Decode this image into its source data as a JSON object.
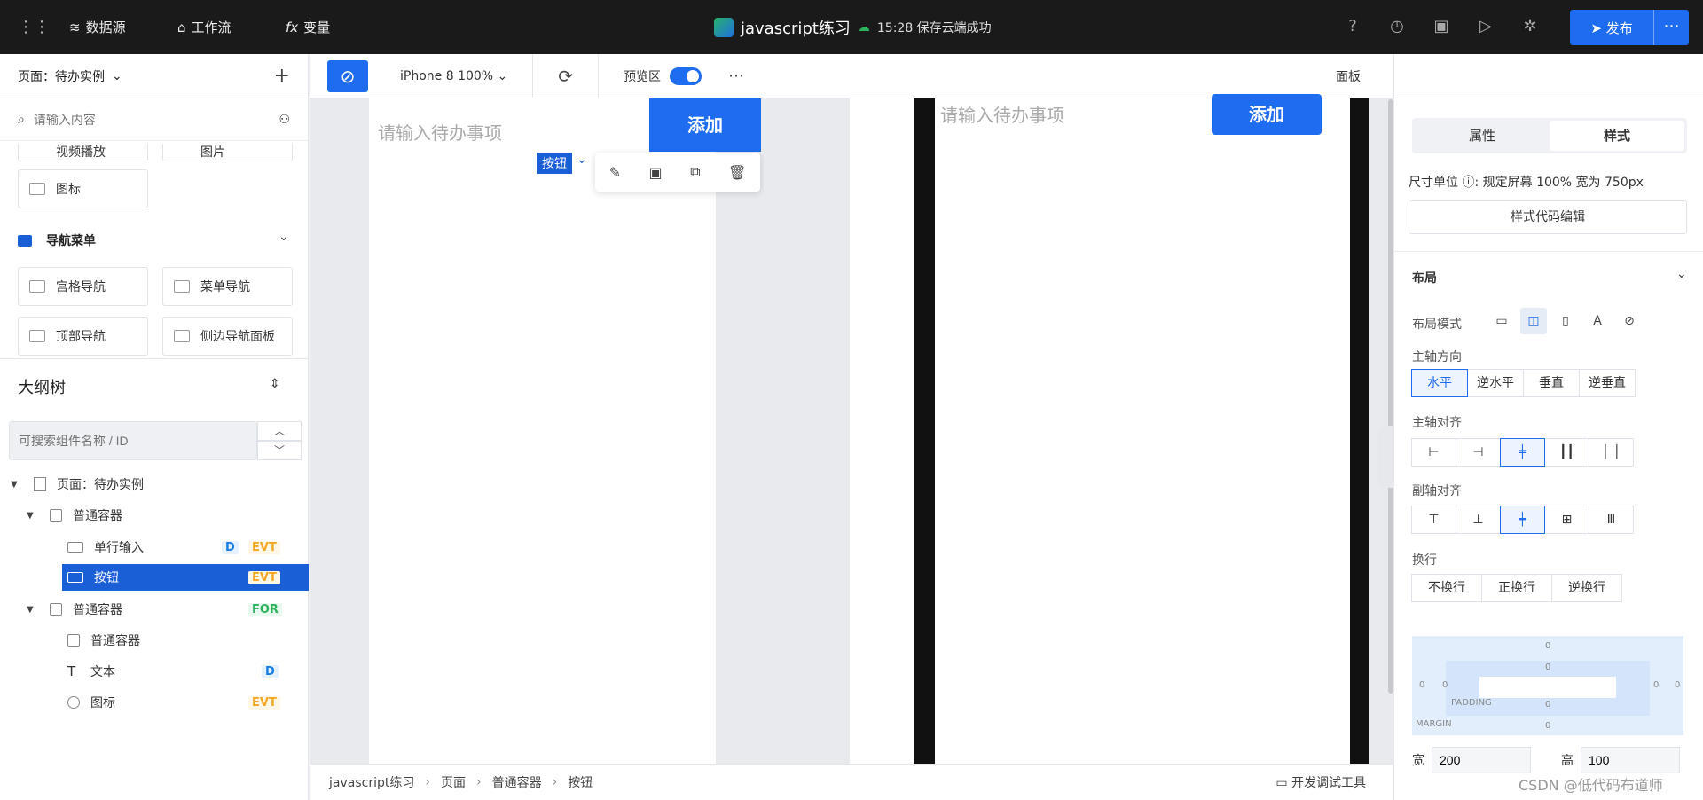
{
  "topbar": {
    "nav": [
      {
        "icon": "database-icon",
        "label": "数据源"
      },
      {
        "icon": "workflow-icon",
        "label": "工作流"
      },
      {
        "icon": "fx-icon",
        "label": "变量"
      }
    ],
    "app_name": "javascript练习",
    "save_status": "15:28 保存云端成功",
    "publish_label": "发布",
    "more_label": "⋯"
  },
  "left": {
    "page_title": "页面：待办实例",
    "search_placeholder": "请输入内容",
    "components": [
      {
        "label": "视频播放"
      },
      {
        "label": "图片"
      },
      {
        "label": "图标"
      }
    ],
    "nav_section": "导航菜单",
    "nav_components": [
      {
        "label": "宫格导航"
      },
      {
        "label": "菜单导航"
      },
      {
        "label": "顶部导航"
      },
      {
        "label": "侧边导航面板"
      }
    ],
    "outline_title": "大纲树",
    "outline_search_placeholder": "可搜索组件名称 / ID",
    "tree": [
      {
        "label": "页面：待办实例"
      },
      {
        "label": "普通容器"
      },
      {
        "label": "单行输入",
        "badges": [
          "D",
          "EVT"
        ]
      },
      {
        "label": "按钮",
        "badges": [
          "EVT"
        ]
      },
      {
        "label": "普通容器",
        "badges": [
          "FOR"
        ]
      },
      {
        "label": "普通容器"
      },
      {
        "label": "文本",
        "badges": [
          "D"
        ]
      },
      {
        "label": "图标",
        "badges": [
          "EVT"
        ]
      }
    ]
  },
  "canvas": {
    "device": "iPhone 8 100%",
    "preview_label": "预览区",
    "panel_label": "面板",
    "input_placeholder": "请输入待办事项",
    "add_button": "添加",
    "selected_tag": "按钮"
  },
  "bottombar": {
    "breadcrumb": [
      "javascript练习",
      "页面",
      "普通容器",
      "按钮"
    ],
    "devtools": "开发调试工具"
  },
  "right": {
    "tabs": [
      "属性",
      "样式"
    ],
    "unit_label": "尺寸单位",
    "unit_value": "规定屏幕 100% 宽为 750px",
    "style_code_btn": "样式代码编辑",
    "layout_title": "布局",
    "layout_mode_label": "布局模式",
    "main_axis_dir_label": "主轴方向",
    "main_axis_dirs": [
      "水平",
      "逆水平",
      "垂直",
      "逆垂直"
    ],
    "main_axis_align_label": "主轴对齐",
    "cross_axis_align_label": "副轴对齐",
    "wrap_label": "换行",
    "wrap_options": [
      "不换行",
      "正换行",
      "逆换行"
    ],
    "padding_label": "PADDING",
    "margin_label": "MARGIN",
    "box_zero": "0",
    "width_label": "宽",
    "width_value": "200",
    "height_label": "高",
    "height_value": "100"
  },
  "watermark": "CSDN @低代码布道师"
}
